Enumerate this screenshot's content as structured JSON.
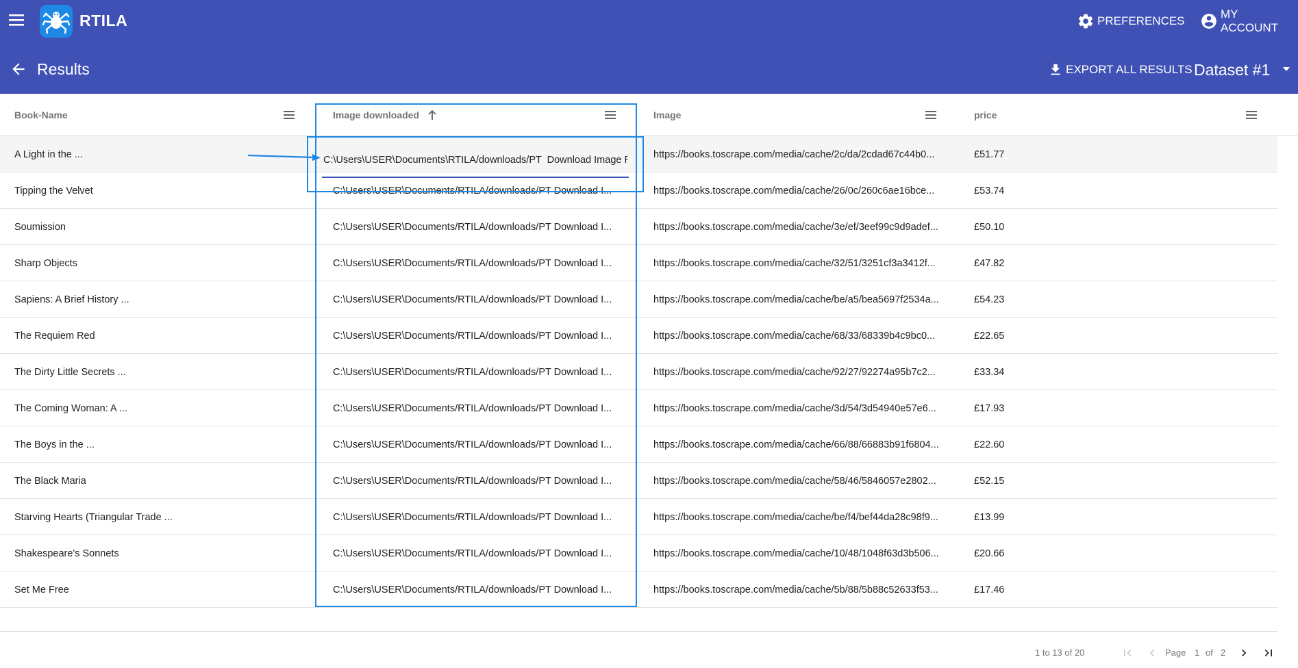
{
  "app": {
    "brand": "RTILA"
  },
  "topbar": {
    "preferences_label": "PREFERENCES",
    "account_label": "MY ACCOUNT"
  },
  "subheader": {
    "title": "Results",
    "export_label": "EXPORT ALL RESULTS",
    "dataset_selected": "Dataset #1"
  },
  "table": {
    "columns": [
      "Book-Name",
      "Image downloaded",
      "Image",
      "price"
    ],
    "sorted_column": "Image downloaded",
    "editing": {
      "value": "C:\\Users\\USER\\Documents\\RTILA/downloads/PT  Download Image F"
    },
    "rows": [
      {
        "name": "A Light in the ...",
        "downloaded": "C:\\Users\\USER\\Documents/RTILA/downloads/PT  Download Image F",
        "image": "https://books.toscrape.com/media/cache/2c/da/2cdad67c44b0...",
        "price": "£51.77"
      },
      {
        "name": "Tipping the Velvet",
        "downloaded": "C:\\Users\\USER\\Documents/RTILA/downloads/PT Download I...",
        "image": "https://books.toscrape.com/media/cache/26/0c/260c6ae16bce...",
        "price": "£53.74"
      },
      {
        "name": "Soumission",
        "downloaded": "C:\\Users\\USER\\Documents/RTILA/downloads/PT Download I...",
        "image": "https://books.toscrape.com/media/cache/3e/ef/3eef99c9d9adef...",
        "price": "£50.10"
      },
      {
        "name": "Sharp Objects",
        "downloaded": "C:\\Users\\USER\\Documents/RTILA/downloads/PT Download I...",
        "image": "https://books.toscrape.com/media/cache/32/51/3251cf3a3412f...",
        "price": "£47.82"
      },
      {
        "name": "Sapiens: A Brief History ...",
        "downloaded": "C:\\Users\\USER\\Documents/RTILA/downloads/PT Download I...",
        "image": "https://books.toscrape.com/media/cache/be/a5/bea5697f2534a...",
        "price": "£54.23"
      },
      {
        "name": "The Requiem Red",
        "downloaded": "C:\\Users\\USER\\Documents/RTILA/downloads/PT Download I...",
        "image": "https://books.toscrape.com/media/cache/68/33/68339b4c9bc0...",
        "price": "£22.65"
      },
      {
        "name": "The Dirty Little Secrets ...",
        "downloaded": "C:\\Users\\USER\\Documents/RTILA/downloads/PT Download I...",
        "image": "https://books.toscrape.com/media/cache/92/27/92274a95b7c2...",
        "price": "£33.34"
      },
      {
        "name": "The Coming Woman: A ...",
        "downloaded": "C:\\Users\\USER\\Documents/RTILA/downloads/PT Download I...",
        "image": "https://books.toscrape.com/media/cache/3d/54/3d54940e57e6...",
        "price": "£17.93"
      },
      {
        "name": "The Boys in the ...",
        "downloaded": "C:\\Users\\USER\\Documents/RTILA/downloads/PT Download I...",
        "image": "https://books.toscrape.com/media/cache/66/88/66883b91f6804...",
        "price": "£22.60"
      },
      {
        "name": "The Black Maria",
        "downloaded": "C:\\Users\\USER\\Documents/RTILA/downloads/PT Download I...",
        "image": "https://books.toscrape.com/media/cache/58/46/5846057e2802...",
        "price": "£52.15"
      },
      {
        "name": "Starving Hearts (Triangular Trade ...",
        "downloaded": "C:\\Users\\USER\\Documents/RTILA/downloads/PT Download I...",
        "image": "https://books.toscrape.com/media/cache/be/f4/bef44da28c98f9...",
        "price": "£13.99"
      },
      {
        "name": "Shakespeare's Sonnets",
        "downloaded": "C:\\Users\\USER\\Documents/RTILA/downloads/PT Download I...",
        "image": "https://books.toscrape.com/media/cache/10/48/1048f63d3b506...",
        "price": "£20.66"
      },
      {
        "name": "Set Me Free",
        "downloaded": "C:\\Users\\USER\\Documents/RTILA/downloads/PT Download I...",
        "image": "https://books.toscrape.com/media/cache/5b/88/5b88c52633f53...",
        "price": "£17.46"
      }
    ]
  },
  "pagination": {
    "summary": "1 to 13 of 20",
    "page_label": "Page",
    "current_page": "1",
    "of_label": "of",
    "total_pages": "2"
  },
  "colors": {
    "primary": "#3f51b5",
    "highlight": "#1e88e5"
  },
  "icons": [
    "menu-icon",
    "spider-logo",
    "gear-icon",
    "account-circle-icon",
    "arrow-back-icon",
    "download-icon",
    "dropdown-caret-icon",
    "column-menu-icon",
    "sort-ascending-icon",
    "first-page-icon",
    "previous-page-icon",
    "next-page-icon",
    "last-page-icon"
  ]
}
